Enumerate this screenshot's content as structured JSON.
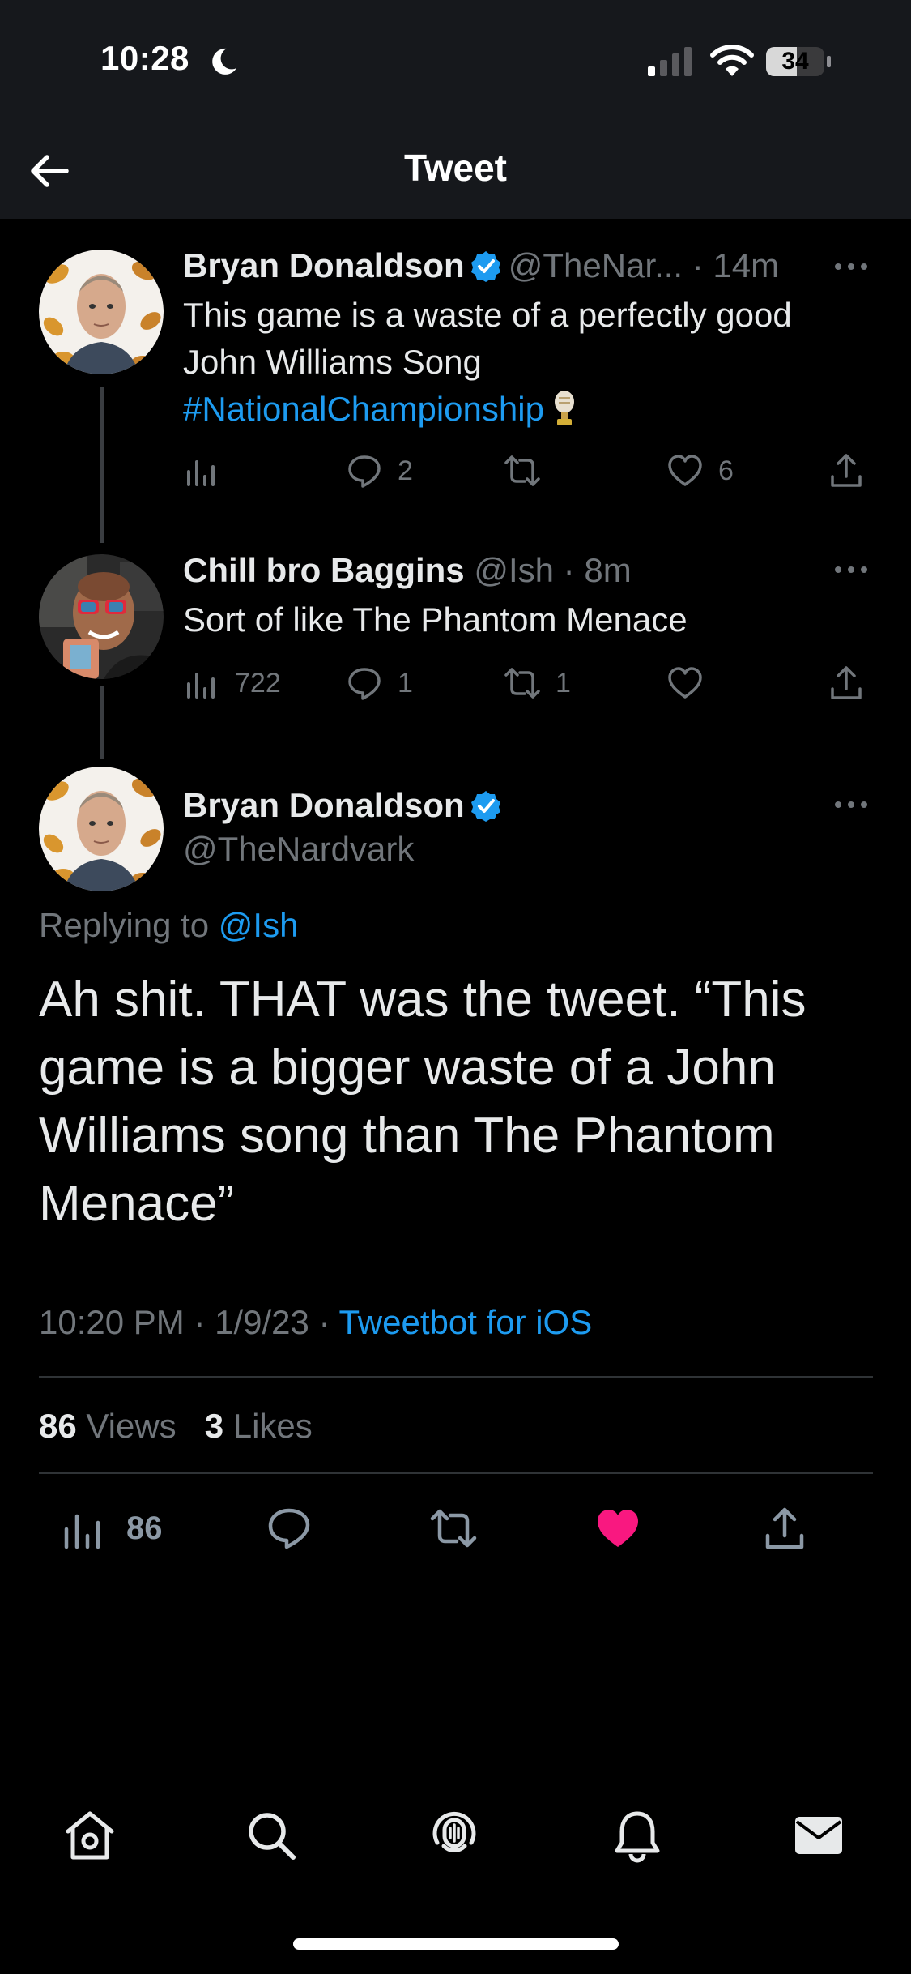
{
  "status_bar": {
    "time": "10:28",
    "battery": "34"
  },
  "nav": {
    "title": "Tweet"
  },
  "tweets": [
    {
      "name": "Bryan Donaldson",
      "handle_time": "@TheNar... · 14m",
      "text_line1": "This game is a waste of a perfectly good",
      "text_line2": "John Williams Song",
      "hashtag": "#NationalChampionship",
      "replies": "2",
      "likes": "6"
    },
    {
      "name": "Chill bro Baggins",
      "handle_time": "@Ish · 8m",
      "text_line1": "Sort of like The Phantom Menace",
      "views": "722",
      "replies": "1",
      "retweets": "1"
    }
  ],
  "main_tweet": {
    "name": "Bryan Donaldson",
    "handle": "@TheNardvark",
    "replying_prefix": "Replying to",
    "replying_handle": "@Ish",
    "text": "Ah shit. THAT was the tweet. “This game is a bigger waste of a John Williams song than The Phantom Menace”",
    "time_date": "10:20 PM · 1/9/23 · ",
    "source": "Tweetbot for iOS",
    "views_count": "86",
    "views_label": "Views",
    "likes_count": "3",
    "likes_label": "Likes",
    "action_views": "86",
    "liked": true,
    "like_color": "#f91880",
    "link_color": "#1d9bf0"
  },
  "tab_bar": {
    "icons": [
      "home-icon",
      "search-icon",
      "spaces-icon",
      "notifications-icon",
      "messages-icon"
    ]
  }
}
